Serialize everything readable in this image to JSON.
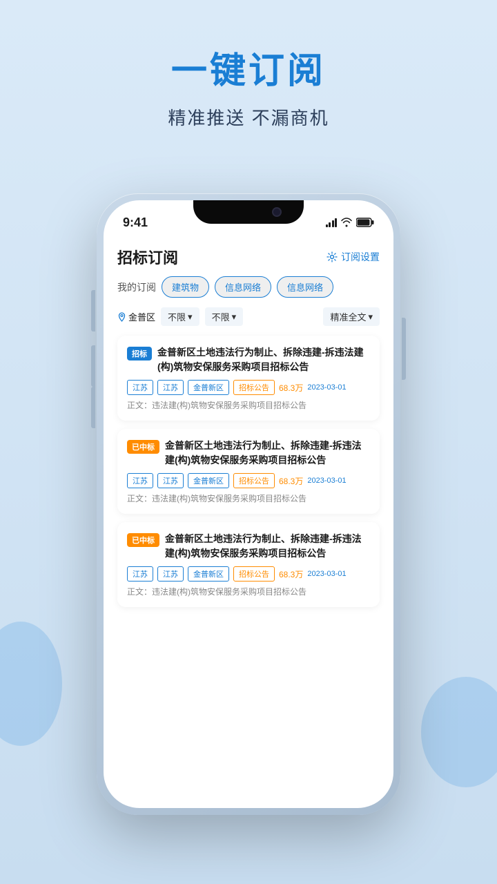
{
  "page": {
    "bg_color": "#d0e4f5"
  },
  "header": {
    "main_title": "一键订阅",
    "sub_title": "精准推送 不漏商机"
  },
  "phone": {
    "status_time": "9:41",
    "app_title": "招标订阅",
    "settings_label": "订阅设置"
  },
  "filters": {
    "my_sub_label": "我的订阅",
    "tags": [
      "建筑物",
      "信息网络",
      "信息网络"
    ],
    "location": "金普区",
    "filter1": "不限",
    "filter2": "不限",
    "filter3": "精准全文"
  },
  "cards": [
    {
      "badge": "招标",
      "badge_type": "recruit",
      "title": "金普新区土地违法行为制止、拆除违建-拆违法建(构)筑物安保服务采购项目招标公告",
      "region1": "江苏",
      "region2": "江苏",
      "region3": "金普新区",
      "tag_type": "招标公告",
      "amount": "68.3万",
      "date": "2023-03-01",
      "preview": "正文：违法建(构)筑物安保服务采购项目招标公告"
    },
    {
      "badge": "已中标",
      "badge_type": "awarded",
      "title": "金普新区土地违法行为制止、拆除违建-拆违法建(构)筑物安保服务采购项目招标公告",
      "region1": "江苏",
      "region2": "江苏",
      "region3": "金普新区",
      "tag_type": "招标公告",
      "amount": "68.3万",
      "date": "2023-03-01",
      "preview": "正文：违法建(构)筑物安保服务采购项目招标公告"
    },
    {
      "badge": "已中标",
      "badge_type": "awarded",
      "title": "金普新区土地违法行为制止、拆除违建-拆违法建(构)筑物安保服务采购项目招标公告",
      "region1": "江苏",
      "region2": "江苏",
      "region3": "金普新区",
      "tag_type": "招标公告",
      "amount": "68.3万",
      "date": "2023-03-01",
      "preview": "正文：违法建(构)筑物安保服务采购项目招标公告"
    }
  ]
}
